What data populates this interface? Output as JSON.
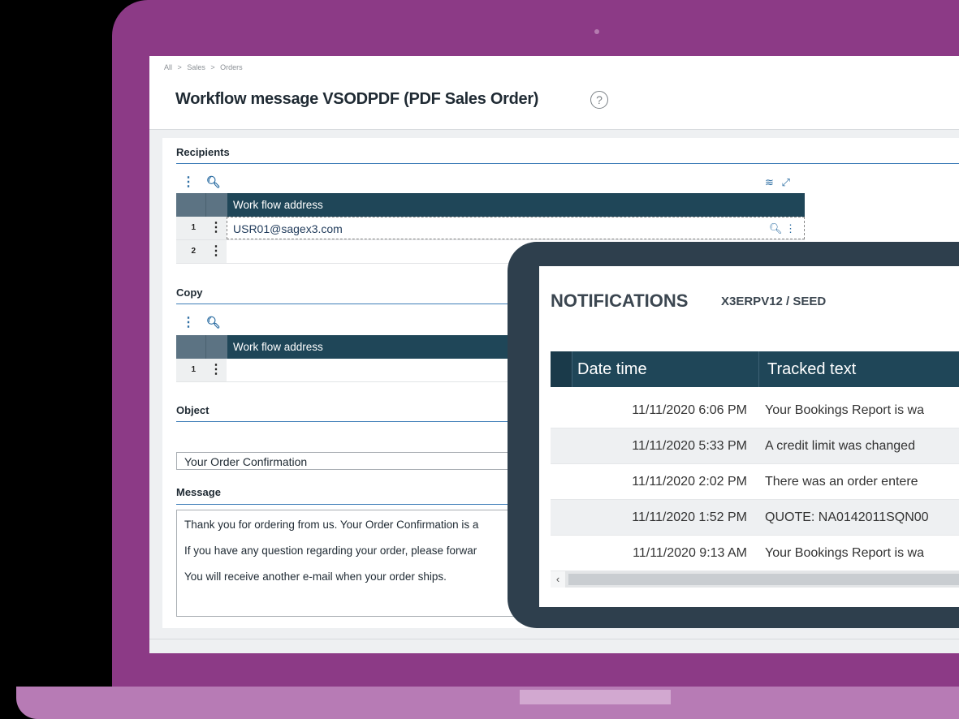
{
  "breadcrumb": [
    "All",
    ">",
    "Sales",
    ">",
    "Orders"
  ],
  "page": {
    "title": "Workflow message VSODPDF (PDF Sales Order)",
    "help": "?"
  },
  "recipients": {
    "title": "Recipients",
    "column": "Work flow address",
    "rows": [
      {
        "num": "1",
        "value": "USR01@sagex3.com"
      },
      {
        "num": "2",
        "value": ""
      }
    ]
  },
  "copy": {
    "title": "Copy",
    "column": "Work flow address",
    "rows": [
      {
        "num": "1",
        "value": ""
      }
    ]
  },
  "object": {
    "title": "Object",
    "value": "Your Order Confirmation"
  },
  "message": {
    "title": "Message",
    "lines": [
      "Thank you for ordering from us. Your Order Confirmation is a",
      "If you have any question regarding your order, please forwar",
      "You will receive another e-mail when your order ships."
    ]
  },
  "notifications": {
    "title": "NOTIFICATIONS",
    "subtitle": "X3ERPV12 / SEED",
    "columns": [
      "Date time",
      "Tracked text"
    ],
    "rows": [
      {
        "date": "11/11/2020 6:06 PM",
        "text": "Your Bookings Report is wa"
      },
      {
        "date": "11/11/2020 5:33 PM",
        "text": "A credit limit was changed"
      },
      {
        "date": "11/11/2020 2:02 PM",
        "text": "There was an order entere"
      },
      {
        "date": "11/11/2020 1:52 PM",
        "text": "QUOTE: NA0142011SQN00"
      },
      {
        "date": "11/11/2020 9:13 AM",
        "text": "Your Bookings Report is wa"
      }
    ]
  },
  "icons": {
    "actions": "vertical-dots-icon",
    "search": "search-icon",
    "layers": "layers-icon",
    "expand": "expand-icon",
    "scroll_left": "chevron-left-icon"
  },
  "colors": {
    "laptop": "#8c3a86",
    "header_dark": "#1f4658",
    "accent": "#2d6ea3",
    "tablet": "#2e3f4d"
  }
}
